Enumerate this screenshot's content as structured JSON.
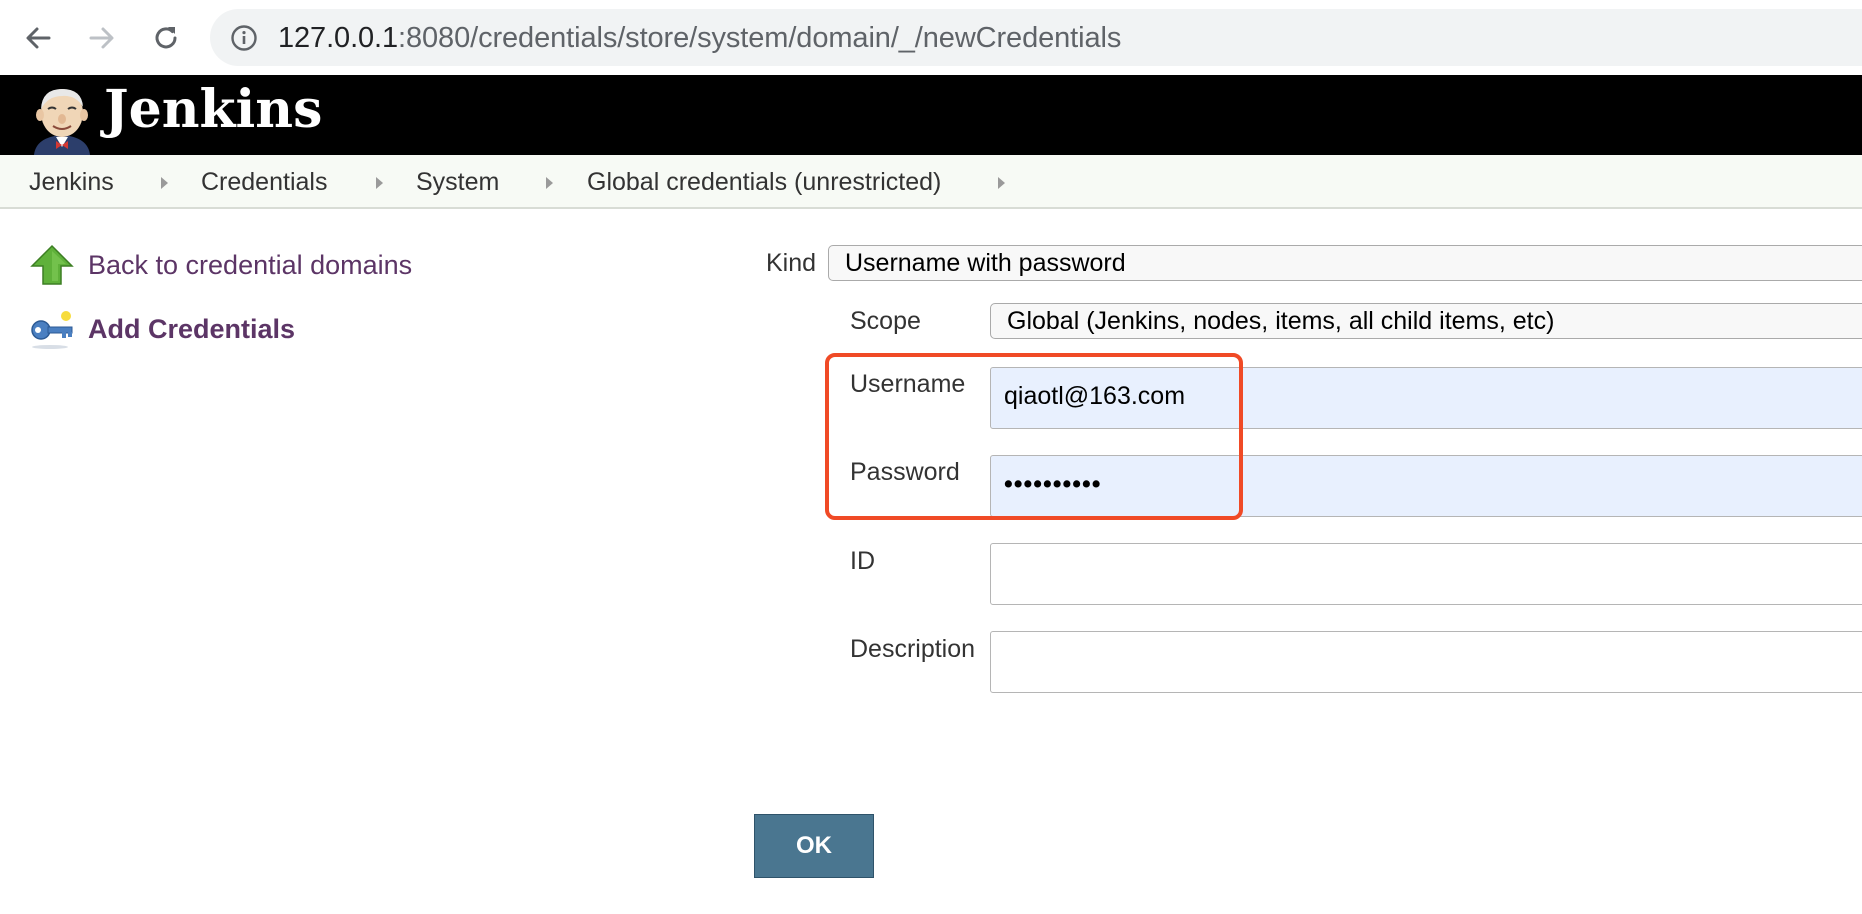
{
  "browser": {
    "url_host": "127.0.0.1",
    "url_rest": ":8080/credentials/store/system/domain/_/newCredentials"
  },
  "header": {
    "title": "Jenkins"
  },
  "breadcrumb": {
    "items": [
      "Jenkins",
      "Credentials",
      "System",
      "Global credentials (unrestricted)"
    ]
  },
  "sidebar": {
    "back_link": "Back to credential domains",
    "add_link": "Add Credentials"
  },
  "form": {
    "kind_label": "Kind",
    "kind_value": "Username with password",
    "scope_label": "Scope",
    "scope_value": "Global (Jenkins, nodes, items, all child items, etc)",
    "username_label": "Username",
    "username_value": "qiaotl@163.com",
    "password_label": "Password",
    "password_value": "••••••••••",
    "id_label": "ID",
    "id_value": "",
    "description_label": "Description",
    "description_value": "",
    "ok_label": "OK"
  },
  "colors": {
    "header_bg": "#000000",
    "link": "#5c3566",
    "autofill_bg": "#e8f0fe",
    "highlight": "#f04a26",
    "ok_button": "#4a7690"
  },
  "icons": [
    "back-arrow-icon",
    "forward-arrow-icon",
    "reload-icon",
    "info-icon",
    "jenkins-butler-icon",
    "up-arrow-icon",
    "key-icon"
  ]
}
